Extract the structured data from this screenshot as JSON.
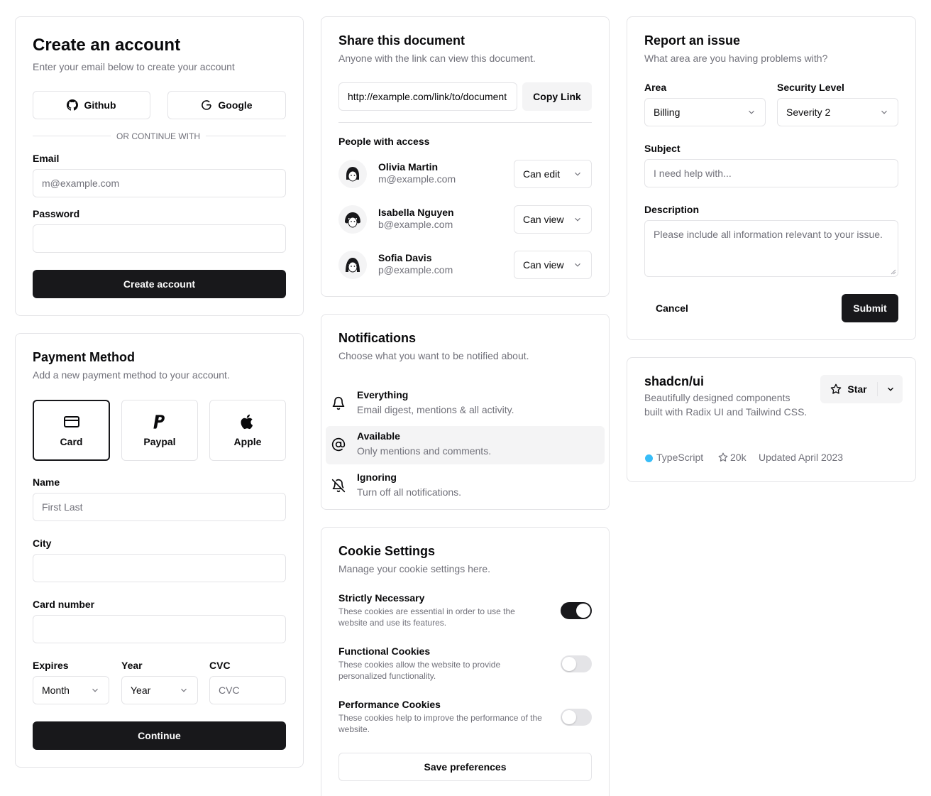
{
  "create_account": {
    "title": "Create an account",
    "subtitle": "Enter your email below to create your account",
    "github_label": "Github",
    "google_label": "Google",
    "divider": "OR CONTINUE WITH",
    "email_label": "Email",
    "email_placeholder": "m@example.com",
    "password_label": "Password",
    "submit_label": "Create account"
  },
  "payment": {
    "title": "Payment Method",
    "subtitle": "Add a new payment method to your account.",
    "options": [
      {
        "label": "Card",
        "icon": "credit-card-icon",
        "selected": true
      },
      {
        "label": "Paypal",
        "icon": "paypal-icon",
        "selected": false
      },
      {
        "label": "Apple",
        "icon": "apple-icon",
        "selected": false
      }
    ],
    "name_label": "Name",
    "name_placeholder": "First Last",
    "city_label": "City",
    "card_number_label": "Card number",
    "expires_label": "Expires",
    "month_value": "Month",
    "year_label": "Year",
    "year_value": "Year",
    "cvc_label": "CVC",
    "cvc_placeholder": "CVC",
    "continue_label": "Continue"
  },
  "share": {
    "title": "Share this document",
    "subtitle": "Anyone with the link can view this document.",
    "link_value": "http://example.com/link/to/document",
    "copy_label": "Copy Link",
    "people_heading": "People with access",
    "people": [
      {
        "name": "Olivia Martin",
        "email": "m@example.com",
        "permission": "Can edit"
      },
      {
        "name": "Isabella Nguyen",
        "email": "b@example.com",
        "permission": "Can view"
      },
      {
        "name": "Sofia Davis",
        "email": "p@example.com",
        "permission": "Can view"
      }
    ]
  },
  "notifications": {
    "title": "Notifications",
    "subtitle": "Choose what you want to be notified about.",
    "items": [
      {
        "title": "Everything",
        "description": "Email digest, mentions & all activity.",
        "icon": "bell-icon",
        "selected": false
      },
      {
        "title": "Available",
        "description": "Only mentions and comments.",
        "icon": "at-sign-icon",
        "selected": true
      },
      {
        "title": "Ignoring",
        "description": "Turn off all notifications.",
        "icon": "bell-off-icon",
        "selected": false
      }
    ]
  },
  "cookies": {
    "title": "Cookie Settings",
    "subtitle": "Manage your cookie settings here.",
    "items": [
      {
        "title": "Strictly Necessary",
        "description": "These cookies are essential in order to use the website and use its features.",
        "enabled": true
      },
      {
        "title": "Functional Cookies",
        "description": "These cookies allow the website to provide personalized functionality.",
        "enabled": false
      },
      {
        "title": "Performance Cookies",
        "description": "These cookies help to improve the performance of the website.",
        "enabled": false
      }
    ],
    "save_label": "Save preferences"
  },
  "report": {
    "title": "Report an issue",
    "subtitle": "What area are you having problems with?",
    "area_label": "Area",
    "area_value": "Billing",
    "security_label": "Security Level",
    "security_value": "Severity 2",
    "subject_label": "Subject",
    "subject_placeholder": "I need help with...",
    "description_label": "Description",
    "description_placeholder": "Please include all information relevant to your issue.",
    "cancel_label": "Cancel",
    "submit_label": "Submit"
  },
  "repo": {
    "name": "shadcn/ui",
    "description": "Beautifully designed components built with Radix UI and Tailwind CSS.",
    "star_label": "Star",
    "language": "TypeScript",
    "language_color": "#38bdf8",
    "stars": "20k",
    "updated": "Updated April 2023"
  }
}
